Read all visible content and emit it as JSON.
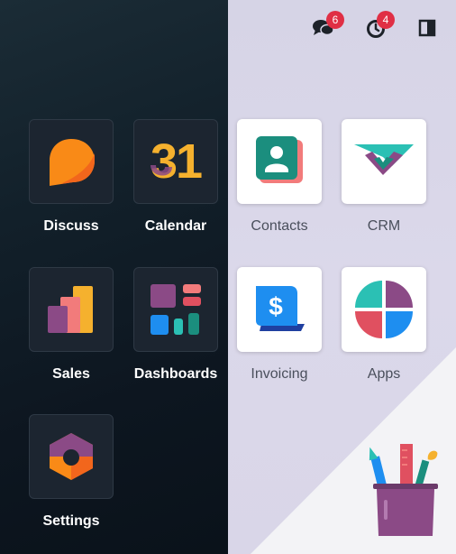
{
  "systray": {
    "messages_count": "6",
    "activities_count": "4",
    "icons": [
      "chat-icon",
      "clock-icon",
      "sidebar-toggle-icon"
    ]
  },
  "apps": [
    {
      "label": "Discuss",
      "icon": "discuss-icon"
    },
    {
      "label": "Calendar",
      "icon": "calendar-icon",
      "icon_text": "31"
    },
    {
      "label": "Contacts",
      "icon": "contacts-icon"
    },
    {
      "label": "CRM",
      "icon": "crm-icon"
    },
    {
      "label": "Sales",
      "icon": "sales-icon"
    },
    {
      "label": "Dashboards",
      "icon": "dashboards-icon"
    },
    {
      "label": "Invoicing",
      "icon": "invoicing-icon",
      "icon_text": "$"
    },
    {
      "label": "Apps",
      "icon": "apps-icon"
    },
    {
      "label": "Settings",
      "icon": "settings-icon"
    }
  ],
  "colors": {
    "badge": "#e02f45",
    "left_panel": "#0f1a22",
    "right_panel": "#d8d6e8",
    "tile_dark": "#1c2530",
    "tile_light": "#ffffff"
  }
}
